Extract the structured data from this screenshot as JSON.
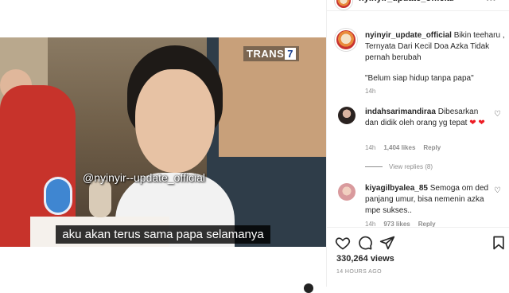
{
  "header": {
    "account_name": "nyinyir_update_official",
    "more_label": "•••"
  },
  "video": {
    "channel_logo_text": "TRANS",
    "channel_logo_number": "7",
    "watermark": "@nyinyir--update_official",
    "subtitle": "aku akan terus sama papa selamanya"
  },
  "caption": {
    "username": "nyinyir_update_official",
    "text": "Bikin teeharu , Ternyata Dari Kecil Doa Azka Tidak pernah berubah",
    "quote": "\"Belum siap hidup tanpa papa\"",
    "time": "14h"
  },
  "comments": [
    {
      "username": "indahsarimandiraa",
      "text": "Dibesarkan dan didik oleh orang yg tepat",
      "time": "14h",
      "likes": "1,404 likes",
      "reply_label": "Reply",
      "view_replies": "View replies (8)"
    },
    {
      "username": "kiyagilbyalea_85",
      "text": "Semoga om ded panjang umur, bisa nemenin azka mpe sukses..",
      "time": "14h",
      "likes": "973 likes",
      "reply_label": "Reply"
    }
  ],
  "actions": {
    "views": "330,264 views",
    "posted_ago": "14 HOURS AGO"
  },
  "icons": {
    "like": "heart-icon",
    "comment": "comment-bubble-icon",
    "share": "paper-plane-icon",
    "save": "bookmark-icon"
  },
  "colors": {
    "like_red": "#ed1c24",
    "muted": "#8e8e8e",
    "text": "#262626"
  }
}
